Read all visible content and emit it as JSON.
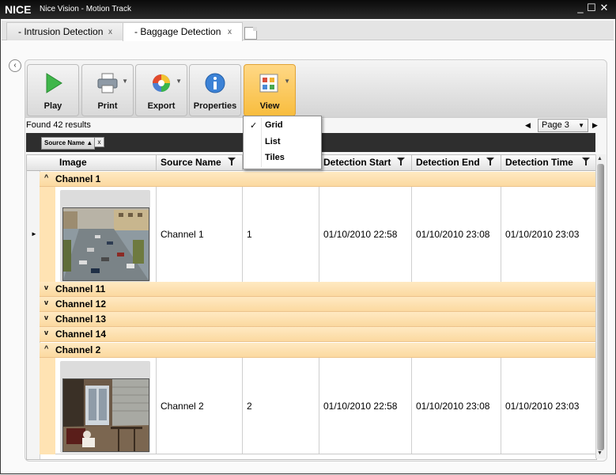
{
  "window": {
    "logo": "NICE",
    "title": "Nice Vision - Motion Track",
    "minimize": "_",
    "maximize": "☐",
    "close": "✕"
  },
  "tabs": [
    {
      "label": "- Intrusion Detection",
      "close": "x"
    },
    {
      "label": "- Baggage Detection",
      "close": "x"
    }
  ],
  "toolbar": {
    "play": "Play",
    "print": "Print",
    "export": "Export",
    "properties": "Properties",
    "view": "View"
  },
  "results": {
    "found": "Found 42 results",
    "page": "Page 3"
  },
  "grouping": {
    "chip": "Source Name ▲",
    "chip_close": "x"
  },
  "view_menu": {
    "items": [
      "Grid",
      "List",
      "Tiles"
    ],
    "selected": "Grid",
    "check": "✓"
  },
  "grid": {
    "columns": [
      "Image",
      "Source Name",
      "",
      "Detection Start",
      "Detection End",
      "Detection Time"
    ],
    "groups": [
      {
        "label": "Channel 1",
        "expanded": true,
        "row": {
          "source": "Channel 1",
          "id": "1",
          "start": "01/10/2010 22:58",
          "end": "01/10/2010 23:08",
          "time": "01/10/2010 23:03"
        }
      },
      {
        "label": "Channel 11",
        "expanded": false
      },
      {
        "label": "Channel 12",
        "expanded": false
      },
      {
        "label": "Channel 13",
        "expanded": false
      },
      {
        "label": "Channel 14",
        "expanded": false
      },
      {
        "label": "Channel 2",
        "expanded": true,
        "row": {
          "source": "Channel 2",
          "id": "2",
          "start": "01/10/2010 22:58",
          "end": "01/10/2010 23:08",
          "time": "01/10/2010 23:03"
        }
      }
    ],
    "expanded_chevron": "^",
    "collapsed_chevron": "v",
    "row_marker": "►"
  },
  "colors": {
    "group_row": "#fbd9a0",
    "view_button": "#f8bd3e",
    "titlebar": "#0a0a0a"
  }
}
